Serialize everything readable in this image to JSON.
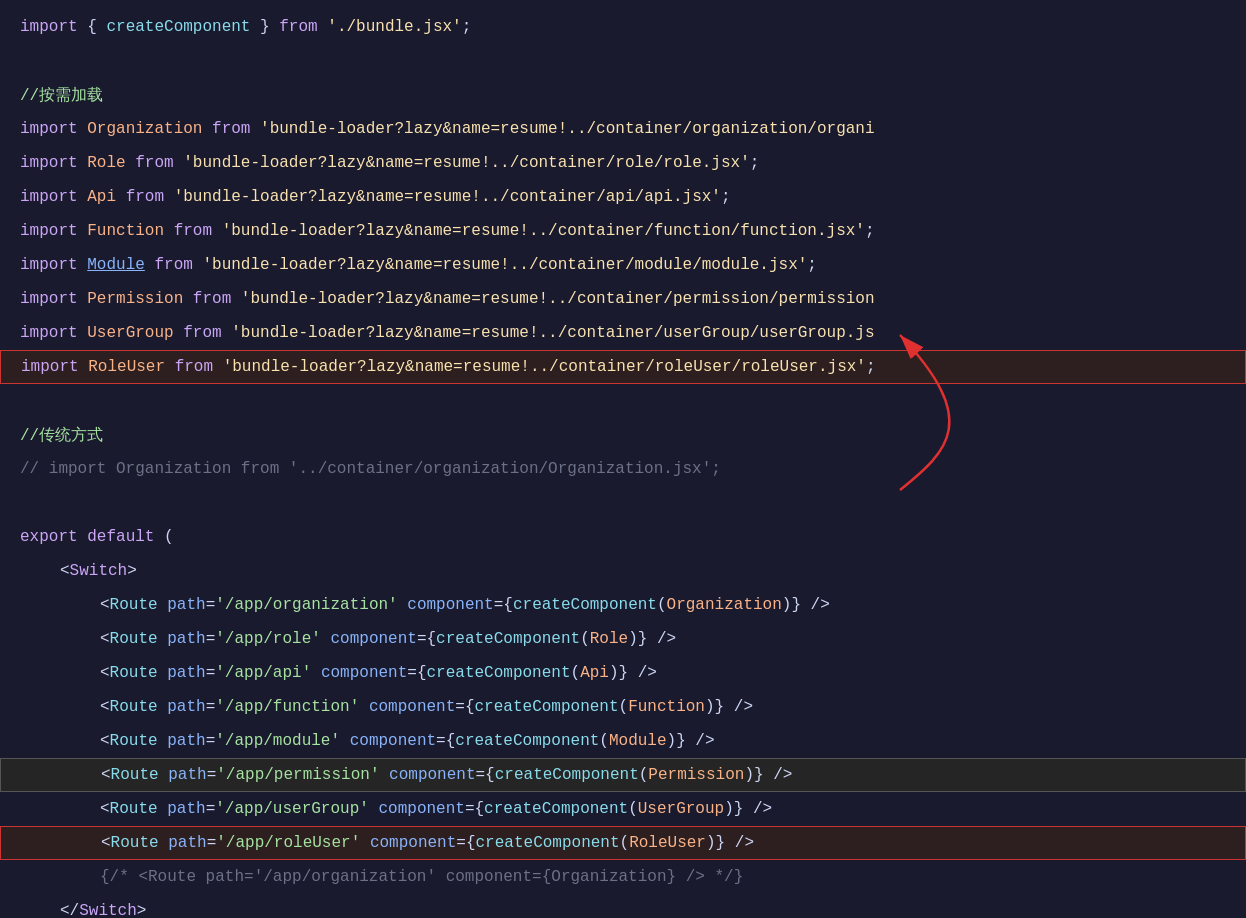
{
  "code": {
    "lines": [
      {
        "id": "l1",
        "highlighted": false,
        "content": "import_createcomponent"
      }
    ]
  },
  "colors": {
    "background": "#1a1a2e",
    "highlight_border": "#cc3333",
    "arrow_color": "#e03030"
  }
}
